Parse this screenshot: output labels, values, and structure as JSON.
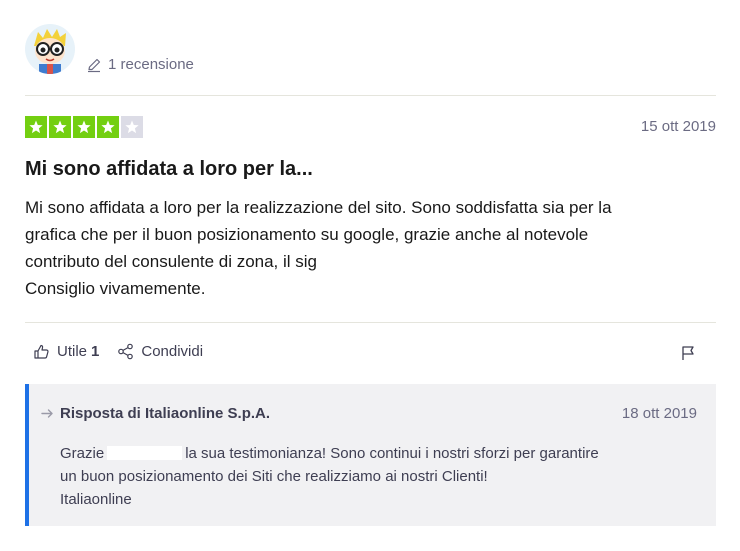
{
  "reviewer": {
    "avatar_icon": "cartoon-avatar-icon",
    "review_count": "1 recensione"
  },
  "review": {
    "rating": 4,
    "rating_max": 5,
    "star_color": "#73cf11",
    "date": "15 ott 2019",
    "title": "Mi sono affidata a loro per la...",
    "body_lines": [
      "Mi sono affidata a loro per la realizzazione del sito. Sono soddisfatta sia per la",
      "grafica che per il buon posizionamento su google, grazie anche al notevole",
      "contributo del consulente di zona, il sig",
      "Consiglio vivamemente."
    ]
  },
  "actions": {
    "useful_label": "Utile",
    "useful_count": "1",
    "share_label": "Condividi",
    "flag_icon": "flag-icon"
  },
  "reply": {
    "accent_color": "#1e71e6",
    "title": "Risposta di Italiaonline S.p.A.",
    "date": "18 ott 2019",
    "line1_start": "Grazie",
    "line1_end": "la sua testimonianza! Sono continui i nostri sforzi per garantire",
    "line2": "un buon posizionamento dei Siti che realizziamo ai nostri Clienti!",
    "line3": "Italiaonline"
  }
}
